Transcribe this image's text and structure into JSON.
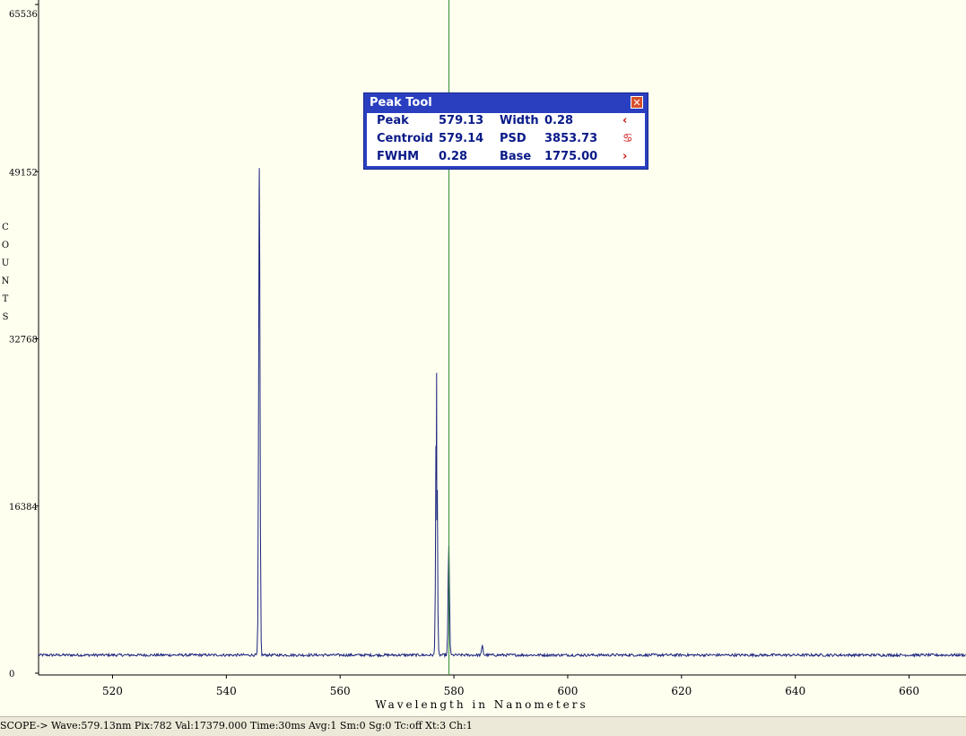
{
  "chart_data": {
    "type": "line",
    "xlabel": "Wavelength in Nanometers",
    "ylabel": "COUNTS",
    "xlim": [
      507,
      670
    ],
    "ylim": [
      0,
      65536
    ],
    "x_ticks": [
      520,
      540,
      560,
      580,
      600,
      620,
      640,
      660
    ],
    "y_ticks": [
      0,
      16384,
      32768,
      49152,
      65536
    ],
    "baseline": 1775,
    "series_color": "#1a237e",
    "cursor_wavelength": 579.13,
    "cursor_color": "#2e8b2e",
    "peaks": [
      {
        "x": 545.8,
        "y": 49500
      },
      {
        "x": 576.9,
        "y": 19000
      },
      {
        "x": 577.0,
        "y": 15000
      },
      {
        "x": 579.1,
        "y": 12500
      },
      {
        "x": 585.0,
        "y": 2700
      }
    ]
  },
  "peak_tool": {
    "title": "Peak Tool",
    "close_icon": "close-icon",
    "rows": [
      {
        "label": "Peak",
        "value": "579.13",
        "label2": "Width",
        "value2": "0.28",
        "icon": "‹"
      },
      {
        "label": "Centroid",
        "value": "579.14",
        "label2": "PSD",
        "value2": "3853.73",
        "icon": "♋"
      },
      {
        "label": "FWHM",
        "value": "0.28",
        "label2": "Base",
        "value2": "1775.00",
        "icon": "›"
      }
    ]
  },
  "status_bar": {
    "text": "SCOPE-> Wave:579.13nm Pix:782 Val:17379.000 Time:30ms Avg:1 Sm:0 Sg:0 Tc:off Xt:3 Ch:1"
  }
}
